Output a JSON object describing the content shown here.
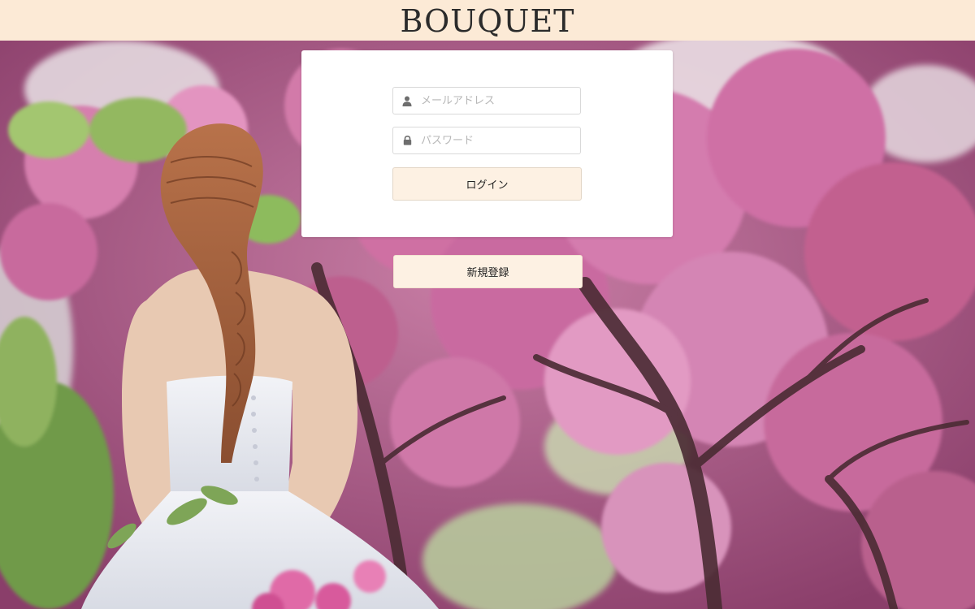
{
  "header": {
    "brand": "BOUQUET",
    "background_color": "#fcead6"
  },
  "login_form": {
    "email": {
      "placeholder": "メールアドレス",
      "value": "",
      "icon": "user-icon"
    },
    "password": {
      "placeholder": "パスワード",
      "value": "",
      "icon": "lock-icon"
    },
    "login_label": "ログイン"
  },
  "signup_label": "新規登録",
  "colors": {
    "button_background": "#fdf1e3",
    "card_background": "#ffffff"
  },
  "background_image": {
    "icon": "cherry-blossom-bride-photo"
  }
}
